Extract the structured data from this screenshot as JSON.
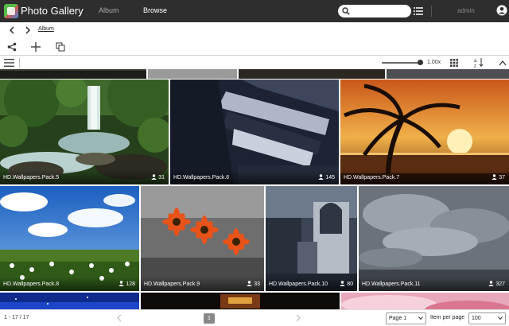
{
  "app": {
    "title": "Photo Gallery",
    "user": "admin"
  },
  "nav": {
    "album": "Album",
    "browse": "Browse"
  },
  "search": {
    "placeholder": ""
  },
  "breadcrumb": {
    "current": "Album"
  },
  "toolbar": {
    "zoom_level": "1.00x",
    "zoom_fraction": 1.0
  },
  "gallery": {
    "tiles": [
      {
        "name": "HD.Wallpapers.Pack.5",
        "count": "31",
        "scene": "waterfall"
      },
      {
        "name": "HD.Wallpapers.Pack.6",
        "count": "145",
        "scene": "architecture"
      },
      {
        "name": "HD.Wallpapers.Pack.7",
        "count": "37",
        "scene": "sunset-palm"
      },
      {
        "name": "HD.Wallpapers.Pack.8",
        "count": "128",
        "scene": "meadow"
      },
      {
        "name": "HD.Wallpapers.Pack.9",
        "count": "33",
        "scene": "flowers"
      },
      {
        "name": "HD.Wallpapers.Pack.10",
        "count": "80",
        "scene": "ruins"
      },
      {
        "name": "HD.Wallpapers.Pack.11",
        "count": "327",
        "scene": "clouds"
      }
    ]
  },
  "footer": {
    "range": "1 - 17 / 17",
    "current_page": "1",
    "page_select": "Page 1",
    "items_per_page_label": "Item per page",
    "items_per_page": "100"
  },
  "colors": {
    "topbar": "#2e2e2e",
    "page_chip": "#888888"
  },
  "icons": [
    "search-icon",
    "list-icon",
    "account-icon",
    "back-icon",
    "forward-icon",
    "share-icon",
    "add-icon",
    "copy-icon",
    "menu-icon",
    "grid-icon",
    "sort-az-icon",
    "chevron-up-icon",
    "people-icon",
    "chevron-left-icon",
    "chevron-right-icon",
    "chevron-down-icon"
  ]
}
